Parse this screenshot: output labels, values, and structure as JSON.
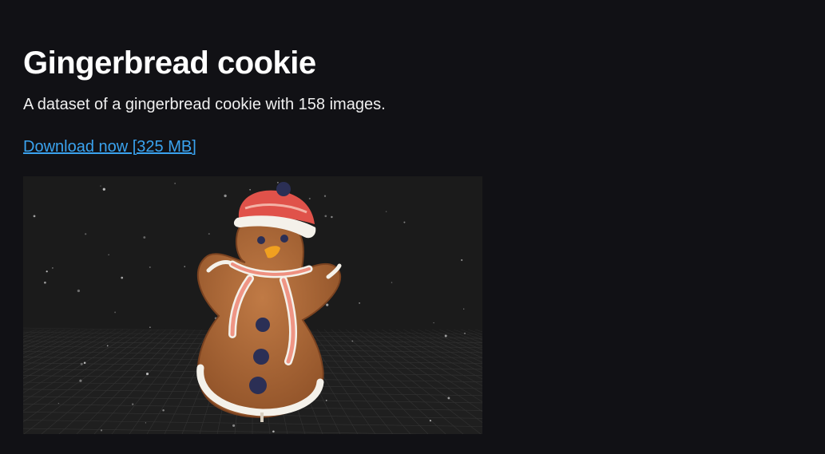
{
  "dataset": {
    "title": "Gingerbread cookie",
    "description": "A dataset of a gingerbread cookie with 158 images.",
    "download_label": "Download now [325 MB]"
  },
  "preview": {
    "subject": "gingerbread snowman cookie point cloud",
    "background_color": "#1b1b1b",
    "cookie_color": "#b06a3a",
    "icing_color": "#f4f1ea",
    "hat_color": "#e0524a",
    "accent_color": "#3aa3ef"
  }
}
